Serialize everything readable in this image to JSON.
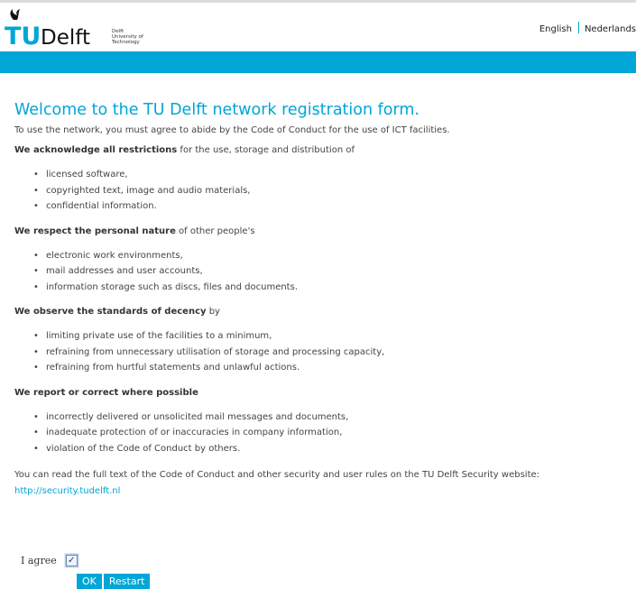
{
  "header": {
    "logo": {
      "mark": "TU",
      "name": "Delft",
      "tagline": [
        "Delft",
        "University of",
        "Technology"
      ]
    },
    "languages": [
      "English",
      "Nederlands"
    ]
  },
  "main": {
    "title": "Welcome to the TU Delft network registration form.",
    "intro": "To use the network, you must agree to abide by the Code of Conduct for the use of ICT facilities.",
    "sections": [
      {
        "lead_bold": "We acknowledge all restrictions",
        "lead_rest": " for the use, storage and distribution of",
        "items": [
          "licensed software,",
          "copyrighted text, image and audio materials,",
          "confidential information."
        ]
      },
      {
        "lead_bold": "We respect the personal nature",
        "lead_rest": " of other people's",
        "items": [
          "electronic work environments,",
          "mail addresses and user accounts,",
          "information storage such as discs, files and documents."
        ]
      },
      {
        "lead_bold": "We observe the standards of decency",
        "lead_rest": " by",
        "items": [
          "limiting private use of the facilities to a minimum,",
          "refraining from unnecessary utilisation of storage and processing capacity,",
          "refraining from hurtful statements and unlawful actions."
        ]
      },
      {
        "lead_bold": "We report or correct where possible",
        "lead_rest": "",
        "items": [
          "incorrectly delivered or unsolicited mail messages and documents,",
          "inadequate protection of or inaccuracies in company information,",
          "violation of the Code of Conduct by others."
        ]
      }
    ],
    "footer_text": "You can read the full text of the Code of Conduct and other security and user rules on the TU Delft Security website:",
    "footer_link": "http://security.tudelft.nl"
  },
  "form": {
    "agree_label": "I agree",
    "agree_checked": true,
    "ok_label": "OK",
    "restart_label": "Restart"
  },
  "colors": {
    "accent": "#00a6d6",
    "text": "#444444"
  }
}
